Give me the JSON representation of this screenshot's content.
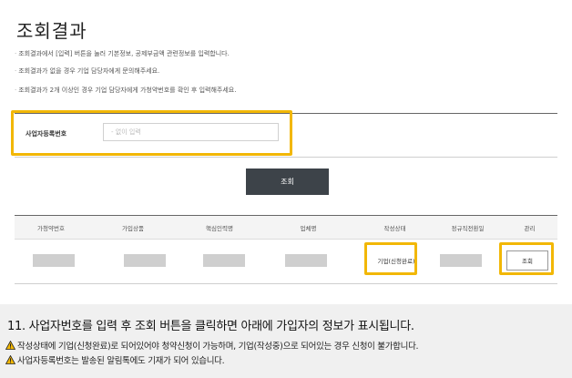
{
  "page": {
    "title": "조회결과"
  },
  "notes": [
    "조회결과에서 [입력] 버튼을 눌러 기본정보, 공제부금액 관련정보를 입력합니다.",
    "조회결과가 없을 경우 기업 담당자에게 문의해주세요.",
    "조회결과가 2개 이상인 경우 기업 담당자에게 가청약번호를 확인 후 입력해주세요."
  ],
  "search": {
    "label": "사업자등록번호",
    "placeholder": "- 없이 입력",
    "button_label": "조회"
  },
  "table": {
    "headers": [
      "가청약번호",
      "가입상품",
      "핵심인력명",
      "업체명",
      "작성상태",
      "정규직전환일",
      "관리"
    ],
    "row": {
      "status": "기업(신청완료)",
      "action_label": "조회"
    }
  },
  "footer": {
    "step_text": "11. 사업자번호를 입력 후 조회 버튼을 클릭하면 아래에 가입자의 정보가 표시됩니다.",
    "warnings": [
      "작성상태에 기업(신청완료)로 되어있어야 청약신청이 가능하며, 기업(작성중)으로 되어있는 경우 신청이 불가합니다.",
      "사업자등록번호는 발송된 알림톡에도 기재가 되어 있습니다."
    ],
    "warning_color": "#f2b705",
    "highlight_color": "#f2b705"
  }
}
